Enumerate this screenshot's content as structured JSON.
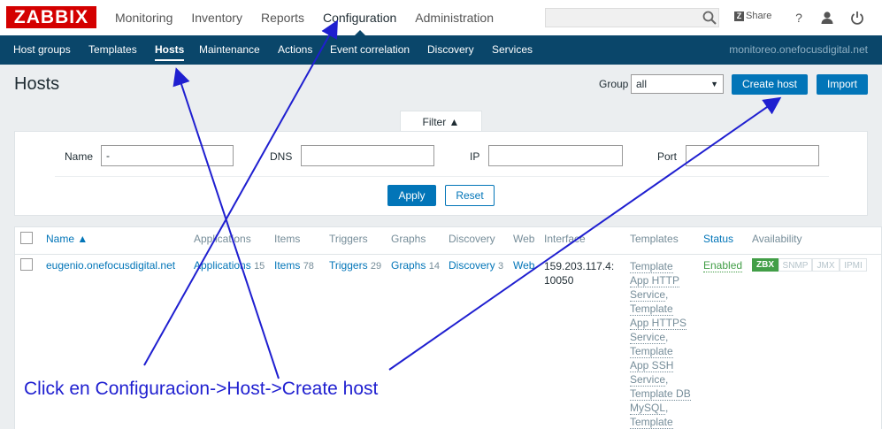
{
  "logo": "ZABBIX",
  "main_menu": [
    "Monitoring",
    "Inventory",
    "Reports",
    "Configuration",
    "Administration"
  ],
  "share": "Share",
  "help": "?",
  "sub_menu": [
    "Host groups",
    "Templates",
    "Hosts",
    "Maintenance",
    "Actions",
    "Event correlation",
    "Discovery",
    "Services"
  ],
  "server": "monitoreo.onefocusdigital.net",
  "page_title": "Hosts",
  "group": {
    "label": "Group",
    "value": "all"
  },
  "buttons": {
    "create": "Create host",
    "import": "Import"
  },
  "filter": {
    "tab": "Filter ▲",
    "name_label": "Name",
    "name_value": "-",
    "dns_label": "DNS",
    "ip_label": "IP",
    "port_label": "Port",
    "apply": "Apply",
    "reset": "Reset"
  },
  "table": {
    "headers": [
      "Name ▲",
      "Applications",
      "Items",
      "Triggers",
      "Graphs",
      "Discovery",
      "Web",
      "Interface",
      "Templates",
      "Status",
      "Availability"
    ],
    "row": {
      "name": "eugenio.onefocusdigital.net",
      "applications": "Applications",
      "applications_count": "15",
      "items": "Items",
      "items_count": "78",
      "triggers": "Triggers",
      "triggers_count": "29",
      "graphs": "Graphs",
      "graphs_count": "14",
      "discovery": "Discovery",
      "discovery_count": "3",
      "web": "Web",
      "interface": "159.203.117.4: 10050",
      "templates": [
        "Template App HTTP Service",
        "Template App HTTPS Service",
        "Template App SSH Service",
        "Template DB MySQL",
        "Template"
      ],
      "status": "Enabled",
      "availability": [
        "ZBX",
        "SNMP",
        "JMX",
        "IPMI"
      ]
    }
  },
  "annotation": "Click en Configuracion->Host->Create host",
  "colors": {
    "brand": "#d40000",
    "nav": "#0a466a",
    "link": "#0275b8",
    "enabled": "#429e47",
    "annotation": "#1f1fd0"
  }
}
